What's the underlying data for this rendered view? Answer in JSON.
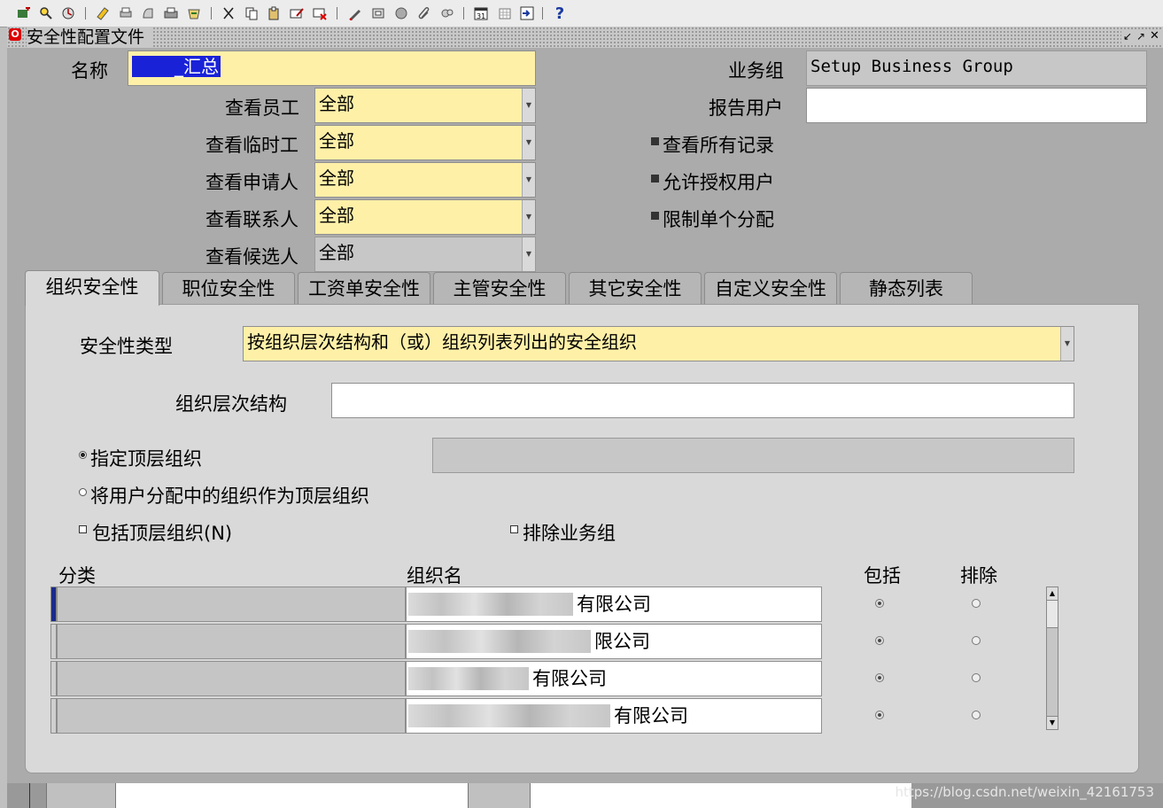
{
  "toolbar": {
    "icons": [
      "new-record-icon",
      "find-icon",
      "navigator-icon",
      "save-icon",
      "print-icon",
      "close-form-icon",
      "folder-icon",
      "cut-icon",
      "copy-icon",
      "paste-icon",
      "clear-record-icon",
      "delete-record-icon",
      "edit-field-icon",
      "zoom-icon",
      "translation-icon",
      "attachments-icon",
      "folder-tools-icon",
      "calendar-icon",
      "calendar-grid-icon",
      "window-help-icon",
      "help-icon"
    ]
  },
  "window": {
    "title": "安全性配置文件"
  },
  "form": {
    "name_label": "名称",
    "name_value": "_汇总",
    "business_group_label": "业务组",
    "business_group_value": "Setup Business Group",
    "view_employees_label": "查看员工",
    "view_employees_value": "全部",
    "view_contingent_label": "查看临时工",
    "view_contingent_value": "全部",
    "view_applicants_label": "查看申请人",
    "view_applicants_value": "全部",
    "view_contacts_label": "查看联系人",
    "view_contacts_value": "全部",
    "view_candidates_label": "查看候选人",
    "view_candidates_value": "全部",
    "reporting_user_label": "报告用户",
    "reporting_user_value": "",
    "view_all_records_label": "查看所有记录",
    "allow_grant_label": "允许授权用户",
    "restrict_single_label": "限制单个分配",
    "view_all_records_checked": true,
    "allow_grant_checked": true,
    "restrict_single_checked": true
  },
  "tabs": [
    "组织安全性",
    "职位安全性",
    "工资单安全性",
    "主管安全性",
    "其它安全性",
    "自定义安全性",
    "静态列表"
  ],
  "active_tab": "组织安全性",
  "org_security": {
    "security_type_label": "安全性类型",
    "security_type_value": "按组织层次结构和（或）组织列表列出的安全组织",
    "hierarchy_label": "组织层次结构",
    "hierarchy_value": "",
    "specify_top_label": "指定顶层组织",
    "user_assignment_top_label": "将用户分配中的组织作为顶层组织",
    "include_top_label": "包括顶层组织(N)",
    "exclude_bg_label": "排除业务组",
    "col_category": "分类",
    "col_org_name": "组织名",
    "col_include": "包括",
    "col_exclude": "排除",
    "rows": [
      {
        "org_suffix": "有限公司",
        "include": true
      },
      {
        "org_suffix": "限公司",
        "include": true
      },
      {
        "org_suffix": "有限公司",
        "include": true
      },
      {
        "org_suffix": "有限公司",
        "include": true
      }
    ]
  },
  "watermark": "https://blog.csdn.net/weixin_42161753"
}
